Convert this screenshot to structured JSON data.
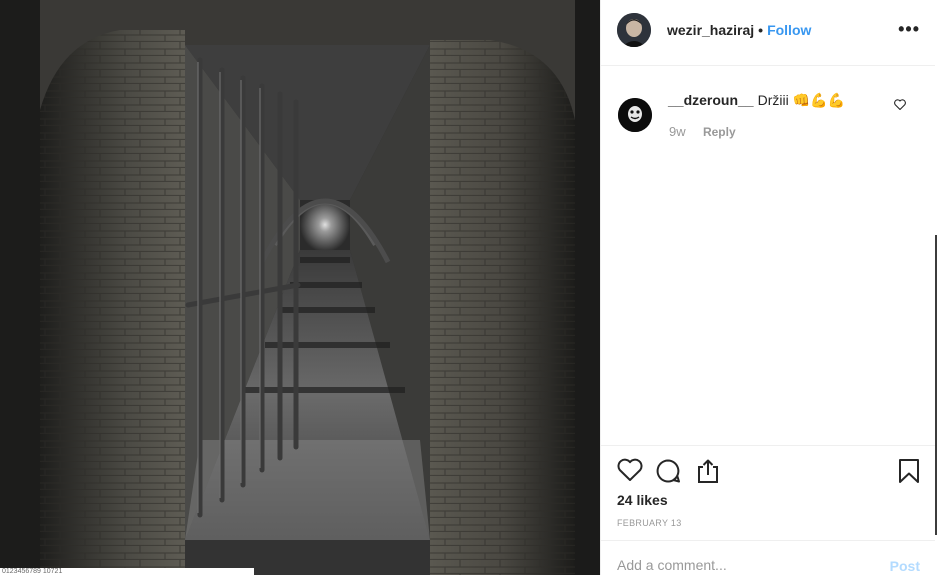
{
  "post": {
    "photo_caption": "0123456789 10721",
    "author": {
      "username": "wezir_haziraj",
      "separator": "•",
      "follow_label": "Follow",
      "more_label": "•••"
    },
    "comments": [
      {
        "username": "__dzeroun__",
        "text": "Držiii 👊💪💪",
        "age": "9w",
        "reply_label": "Reply"
      }
    ],
    "likes_label": "24 likes",
    "date_label": "FEBRUARY 13",
    "add_comment": {
      "placeholder": "Add a comment...",
      "post_label": "Post"
    }
  },
  "icons": {
    "like": "heart-icon",
    "comment": "comment-bubble-icon",
    "share": "share-icon",
    "save": "bookmark-icon",
    "more": "more-options-icon",
    "comment_like": "small-heart-icon"
  },
  "colors": {
    "link_blue": "#3897f0",
    "post_disabled": "#b3dbff",
    "muted_text": "#999999",
    "divider": "#efefef"
  }
}
